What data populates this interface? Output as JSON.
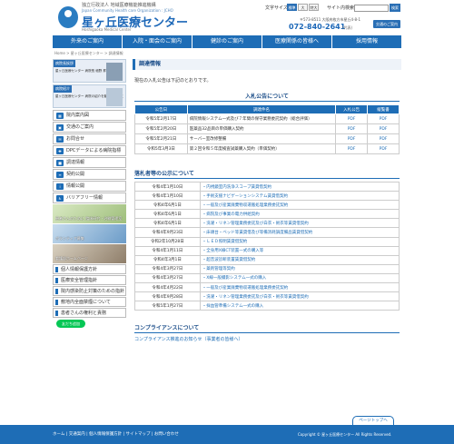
{
  "header": {
    "org_line": "独立行政法人 地域医療機能推進機構",
    "org_en": "Japan Community Health care Organization : JCHO",
    "site_name": "星ヶ丘医療センター",
    "site_name_en": "Hoshigaoka Medical Center",
    "font_size_label": "文字サイズ",
    "font_sizes": [
      "標準",
      "大",
      "特大"
    ],
    "search_label": "サイト内検索",
    "search_button": "検索",
    "address": "〒573-8511 大阪府枚方市星丘4-8-1",
    "tel": "072-840-2641",
    "tel_note": "(代表)",
    "access_button": "交通のご案内"
  },
  "nav": {
    "items": [
      "外来のご案内",
      "入院・面会のご案内",
      "健診のご案内",
      "医療関係の皆様へ",
      "採用情報"
    ]
  },
  "breadcrumb": "Home > 星ヶ丘医療センター > 調達情報",
  "sidebar": {
    "banner1_tag": "病院長挨拶",
    "banner1_text": "星ヶ丘医療センター 病院長 細野 昇",
    "banner2_tag": "病院紹介",
    "banner2_text": "星ヶ丘医療センター 病院の紹介を動画にてご覧",
    "menu": [
      {
        "icon": "hospital-icon",
        "label": "院内案内図"
      },
      {
        "icon": "car-icon",
        "label": "交通のご案内"
      },
      {
        "icon": "mail-icon",
        "label": "お問合せ"
      },
      {
        "icon": "medical-icon",
        "label": "DPCデータによる病院指標"
      },
      {
        "icon": "cart-icon",
        "label": "調達情報"
      },
      {
        "icon": "document-icon",
        "label": "契約公開"
      },
      {
        "icon": "info-icon",
        "label": "情報公開"
      },
      {
        "icon": "wheelchair-icon",
        "label": "バリアフリー情報"
      }
    ],
    "pics": [
      "患者さんのために 臨床研究・治験管理室",
      "ボランティア募集",
      "看護部ホームページ"
    ],
    "menu2": [
      "個人情報保護方針",
      "医療安全管理指針",
      "院内感染防止対策のための指針",
      "敷地内全面禁煙について",
      "患者さんの権利と責務"
    ],
    "line_button": "友だち追加"
  },
  "main": {
    "title": "調達情報",
    "intro": "現在の入札公告は下記のとおりです。",
    "section1_title": "入札公告について",
    "table1_headers": [
      "公告日",
      "調達件名",
      "入札公告",
      "縦覧書"
    ],
    "table1_rows": [
      [
        "令和5年2月17日",
        "病院情報システム一式及び７年間の保守業務委託契約（総合評価）",
        "PDF",
        "PDF"
      ],
      [
        "令和5年2月20日",
        "医薬品32品目の単価購入契約",
        "PDF",
        "PDF"
      ],
      [
        "令和5年2月21日",
        "サーバー室改修整備",
        "PDF",
        "PDF"
      ],
      [
        "令和5年3月3日",
        "第２回令和５年度検査試薬購入契約（単価契約）",
        "PDF",
        "PDF"
      ]
    ],
    "section2_title": "落札者等の公示について",
    "table2_rows": [
      [
        "令和4年1月10日",
        "内視鏡室内洗浄スコープ賃貸借契約"
      ],
      [
        "令和4年1月10日",
        "手術支援ナビゲーションシステム賃貸借契約"
      ],
      [
        "令和4年6月1日",
        "一般及び産業廃棄物収運搬処理業務委託契約"
      ],
      [
        "令和4年6月1日",
        "病院及び事業の電力供給契約"
      ],
      [
        "令和4年6月1日",
        "洗濯・リネン管理業務委託及び白衣・術衣等賃貸借契約"
      ],
      [
        "令和4年9月23日",
        "床頭台・ベッド等賃貸借及び等備消耗調度備品賃貸借契約"
      ],
      [
        "令和2年10月28日",
        "ＬＥＤ照明賃貸借契約"
      ],
      [
        "令和4年1月11日",
        "全身用X線CT装置一式の購入等"
      ],
      [
        "令和4年3月1日",
        "超音波診断装置賃貸借契約"
      ],
      [
        "令和4年3月27日",
        "薬剤管理等契約"
      ],
      [
        "令和4年3月27日",
        "X線一般撮影システム一式の購入"
      ],
      [
        "令和4年4月22日",
        "一般及び産業廃棄物収運搬処理業務委託契約"
      ],
      [
        "令和4年9月28日",
        "洗濯・リネン管理業務委託及び白衣・術衣等賃貸借契約"
      ],
      [
        "令和5年1月27日",
        "採血管準備システム一式の購入"
      ]
    ],
    "section3_title": "コンプライアンスについて",
    "compliance_link": "コンプライアンス推進のお知らせ（事業者の皆様へ）"
  },
  "page_top": "ページトップへ",
  "footer": {
    "links": "ホーム  |  交通案内  |  個人情報保護方針  |  サイトマップ  |  お問い合わせ",
    "copyright": "Copyright © 星ヶ丘医療センター All Rights Reserved."
  }
}
